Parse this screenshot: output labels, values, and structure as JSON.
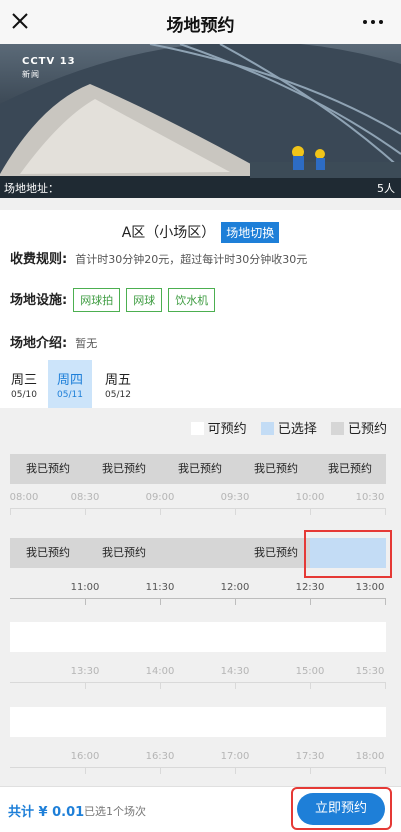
{
  "header": {
    "title": "场地预约",
    "close_icon": "close-icon",
    "more_icon": "more-icon"
  },
  "banner": {
    "logo": "CCTV 13",
    "logo_sub": "新闻",
    "caption": "场地地址：",
    "people": "5人"
  },
  "venue": {
    "area_name": "A区（小场区）",
    "switch_label": "场地切换",
    "fee_label": "收费规则:",
    "fee_text": "首计时30分钟20元，超过每计时30分钟收30元",
    "facilities_label": "场地设施:",
    "facilities": [
      "网球拍",
      "网球",
      "饮水机"
    ],
    "intro_label": "场地介绍:",
    "intro_text": "暂无"
  },
  "days": [
    {
      "day": "周三",
      "date": "05/10",
      "active": false
    },
    {
      "day": "周四",
      "date": "05/11",
      "active": true
    },
    {
      "day": "周五",
      "date": "05/12",
      "active": false
    }
  ],
  "legend": {
    "available": "可预约",
    "selected": "已选择",
    "booked": "已预约"
  },
  "colors": {
    "accent": "#1e7fd8",
    "booked": "#d6d6d6",
    "selected": "#c3dcf5",
    "tag": "#4caf50",
    "highlight": "#e53935"
  },
  "schedule": {
    "rows": [
      {
        "slots": [
          "我已预约",
          "我已预约",
          "我已预约",
          "我已预约",
          "我已预约"
        ],
        "times": [
          "08:00",
          "08:30",
          "09:00",
          "09:30",
          "10:00",
          "10:30"
        ]
      },
      {
        "slots": [
          "我已预约",
          "我已预约",
          "",
          "我已预约",
          ""
        ],
        "times": [
          "",
          "11:00",
          "11:30",
          "12:00",
          "12:30",
          "13:00"
        ]
      },
      {
        "slots": [
          "",
          "",
          "",
          "",
          ""
        ],
        "times": [
          "",
          "13:30",
          "14:00",
          "14:30",
          "15:00",
          "15:30"
        ]
      },
      {
        "slots": [
          "",
          "",
          "",
          "",
          ""
        ],
        "times": [
          "",
          "16:00",
          "16:30",
          "17:00",
          "17:30",
          "18:00"
        ]
      }
    ]
  },
  "footer": {
    "total": "共计 ¥ 0.01",
    "count": "已选1个场次",
    "submit": "立即预约"
  }
}
